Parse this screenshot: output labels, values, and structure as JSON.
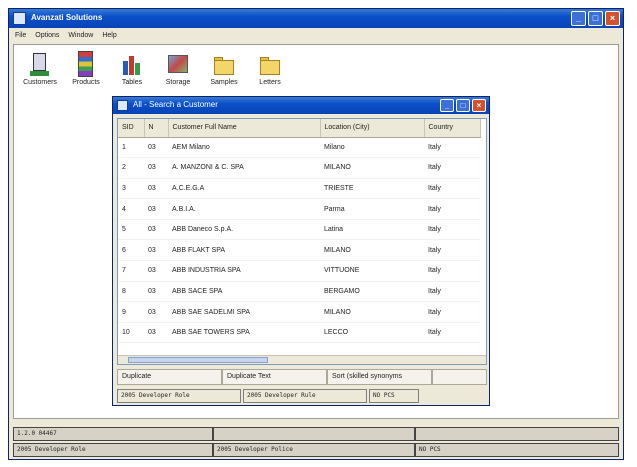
{
  "main_window": {
    "title": "Avanzati Solutions",
    "controls": {
      "minimize": "_",
      "maximize": "□",
      "close": "×"
    }
  },
  "menu": [
    "File",
    "Options",
    "Window",
    "Help"
  ],
  "toolbar": [
    {
      "label": "Customers",
      "icon": "customers-icon"
    },
    {
      "label": "Products",
      "icon": "products-icon"
    },
    {
      "label": "Tables",
      "icon": "tables-icon"
    },
    {
      "label": "Storage",
      "icon": "storage-icon"
    },
    {
      "label": "Samples",
      "icon": "folder-icon"
    },
    {
      "label": "Letters",
      "icon": "folder-icon"
    }
  ],
  "child_window": {
    "title": "All - Search a Customer",
    "grid": {
      "columns": [
        "SID",
        "N",
        "Customer Full Name",
        "Location (City)",
        "Country"
      ],
      "rows": [
        [
          "1",
          "03",
          "AEM Milano",
          "Milano",
          "Italy"
        ],
        [
          "2",
          "03",
          "A. MANZONI & C. SPA",
          "MILANO",
          "Italy"
        ],
        [
          "3",
          "03",
          "A.C.E.G.A",
          "TRIESTE",
          "Italy"
        ],
        [
          "4",
          "03",
          "A.B.I.A.",
          "Parma",
          "Italy"
        ],
        [
          "5",
          "03",
          "ABB Daneco S.p.A.",
          "Latina",
          "Italy"
        ],
        [
          "6",
          "03",
          "ABB FLAKT SPA",
          "MILANO",
          "Italy"
        ],
        [
          "7",
          "03",
          "ABB INDUSTRIA SPA",
          "VITTUONE",
          "Italy"
        ],
        [
          "8",
          "03",
          "ABB SACE SPA",
          "BERGAMO",
          "Italy"
        ],
        [
          "9",
          "03",
          "ABB SAE SADELMI SPA",
          "MILANO",
          "Italy"
        ],
        [
          "10",
          "03",
          "ABB SAE TOWERS SPA",
          "LECCO",
          "Italy"
        ]
      ]
    },
    "buttons": [
      "Duplicate",
      "Duplicate Text",
      "Sort (skilled synonyms"
    ],
    "status": [
      "2005 Developer Role",
      "2005 Developer Rule",
      "NO PCS"
    ]
  },
  "status_bar": {
    "row1": [
      "1.2.0 04467",
      "",
      ""
    ],
    "row2": [
      "2005 Developer Role",
      "2005 Developer Police",
      "NO PCS"
    ]
  }
}
